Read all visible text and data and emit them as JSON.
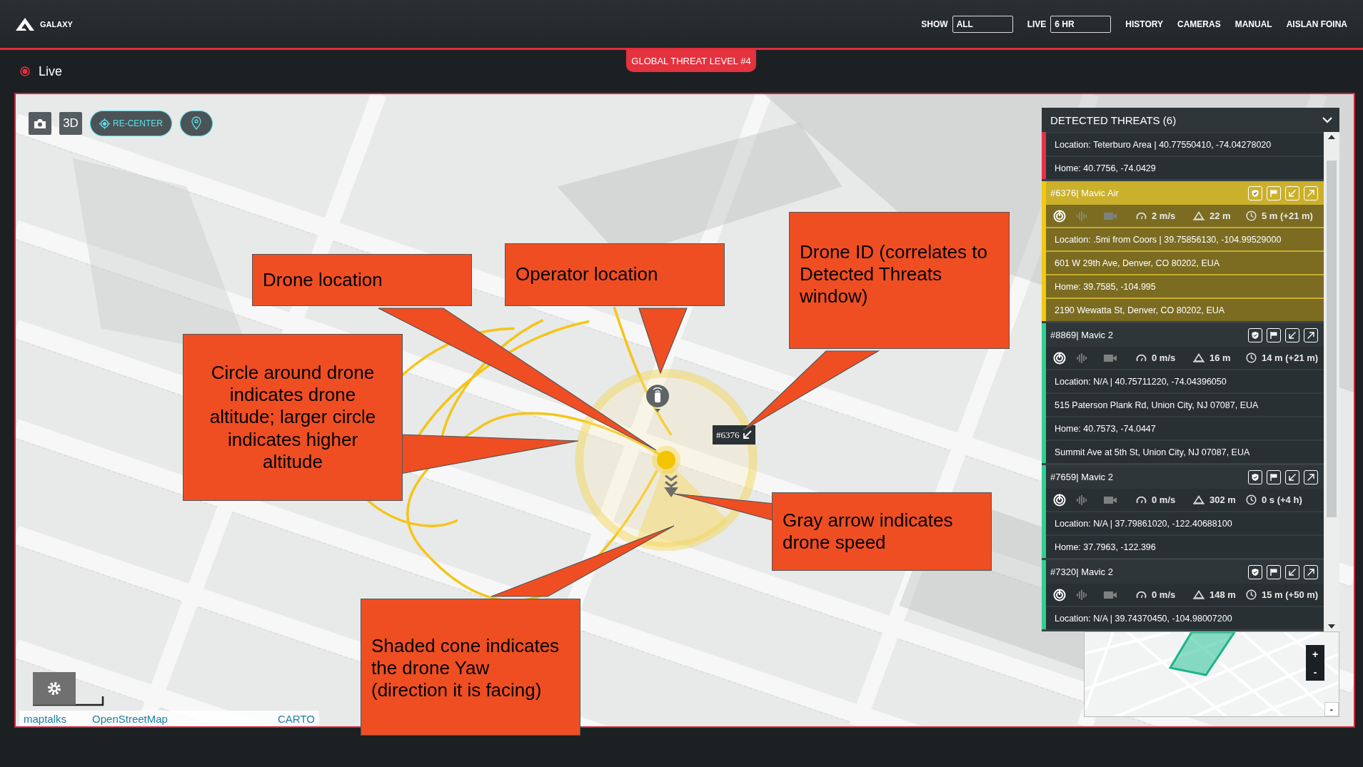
{
  "header": {
    "logo": "GALAXY",
    "show_label": "SHOW",
    "show_value": "ALL",
    "live_label": "LIVE",
    "live_value": "6 HR",
    "nav": [
      {
        "label": "HISTORY"
      },
      {
        "label": "CAMERAS"
      },
      {
        "label": "MANUAL"
      },
      {
        "label": "AISLAN FOINA"
      }
    ]
  },
  "status": {
    "label": "Live"
  },
  "threat_banner": "GLOBAL THREAT LEVEL #4",
  "map_toolbar": {
    "three_d": "3D",
    "recenter": "RE-CENTER"
  },
  "map": {
    "drone_label": "#6376",
    "attribution": [
      "maptalks",
      "OpenStreetMap",
      "CARTO"
    ]
  },
  "threats_panel": {
    "title": "DETECTED THREATS (6)",
    "threats": [
      {
        "color": "#e8304a",
        "selected": false,
        "lines": [
          "Location: Teterburo Area | 40.77550410, -74.04278020",
          "Home: 40.7756, -74.0429"
        ]
      },
      {
        "id": "#6376| Mavic Air",
        "color": "#f2c811",
        "selected": true,
        "speed": "2 m/s",
        "altitude": "22 m",
        "time": "5 m (+21 m)",
        "lines": [
          "Location: .5mi from Coors | 39.75856130, -104.99529000",
          "601 W 29th Ave, Denver, CO 80202, EUA",
          "Home: 39.7585, -104.995",
          "2190 Wewatta St, Denver, CO 80202, EUA"
        ]
      },
      {
        "id": "#8869| Mavic 2",
        "color": "#2ed18f",
        "selected": false,
        "speed": "0 m/s",
        "altitude": "16 m",
        "time": "14 m (+21 m)",
        "lines": [
          "Location: N/A | 40.75711220, -74.04396050",
          "515 Paterson Plank Rd, Union City, NJ 07087, EUA",
          "Home: 40.7573, -74.0447",
          "Summit Ave at 5th St, Union City, NJ 07087, EUA"
        ]
      },
      {
        "id": "#7659| Mavic 2",
        "color": "#2ed18f",
        "selected": false,
        "speed": "0 m/s",
        "altitude": "302 m",
        "time": "0 s (+4 h)",
        "lines": [
          "Location: N/A | 37.79861020, -122.40688100",
          "Home: 37.7963, -122.396"
        ]
      },
      {
        "id": "#7320| Mavic 2",
        "color": "#2ed18f",
        "selected": false,
        "speed": "0 m/s",
        "altitude": "148 m",
        "time": "15 m (+50 m)",
        "lines": [
          "Location: N/A | 39.74370450, -104.98007200"
        ]
      }
    ]
  },
  "minimap": {
    "zoom_in": "+",
    "zoom_out": "-",
    "reset": "-"
  },
  "callouts": [
    {
      "text": "Drone location"
    },
    {
      "text": "Operator location"
    },
    {
      "text": "Drone ID (correlates to Detected Threats window)"
    },
    {
      "text": "Circle around drone indicates drone altitude; larger circle indicates higher altitude"
    },
    {
      "text": "Gray arrow indicates drone speed"
    },
    {
      "text": "Shaded cone indicates the drone Yaw (direction it is facing)"
    }
  ]
}
